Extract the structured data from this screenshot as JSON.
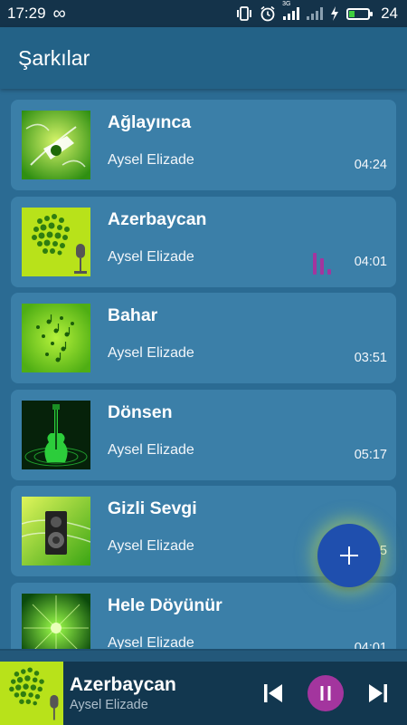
{
  "status_bar": {
    "time": "17:29",
    "infinity_icon": "∞",
    "network_label": "3G",
    "battery_level": "24"
  },
  "app_bar": {
    "title": "Şarkılar"
  },
  "songs": [
    {
      "title": "Ağlayınca",
      "artist": "Aysel Elizade",
      "duration": "04:24",
      "cover": "guitar-art"
    },
    {
      "title": "Azerbaycan",
      "artist": "Aysel Elizade",
      "duration": "04:01",
      "cover": "microphone-art",
      "playing": true
    },
    {
      "title": "Bahar",
      "artist": "Aysel Elizade",
      "duration": "03:51",
      "cover": "notes-art"
    },
    {
      "title": "Dönsen",
      "artist": "Aysel Elizade",
      "duration": "05:17",
      "cover": "green-guitar-art"
    },
    {
      "title": "Gizli Sevgi",
      "artist": "Aysel Elizade",
      "duration": "03:45",
      "cover": "speaker-art"
    },
    {
      "title": "Hele Döyünür",
      "artist": "Aysel Elizade",
      "duration": "04:01",
      "cover": "burst-art"
    }
  ],
  "now_playing": {
    "title": "Azerbaycan",
    "artist": "Aysel Elizade",
    "state": "playing"
  },
  "colors": {
    "accent": "#a3359e",
    "fab": "#1f4fae",
    "card": "#3b7fa8",
    "background": "#2b6b93",
    "app_bar": "#236287",
    "status_bar": "#14334a",
    "player": "#12374f"
  },
  "icons": {
    "fab": "plus-icon",
    "equalizer": "equalizer-icon",
    "prev": "skip-previous-icon",
    "play_pause": "pause-icon",
    "next": "skip-next-icon"
  }
}
